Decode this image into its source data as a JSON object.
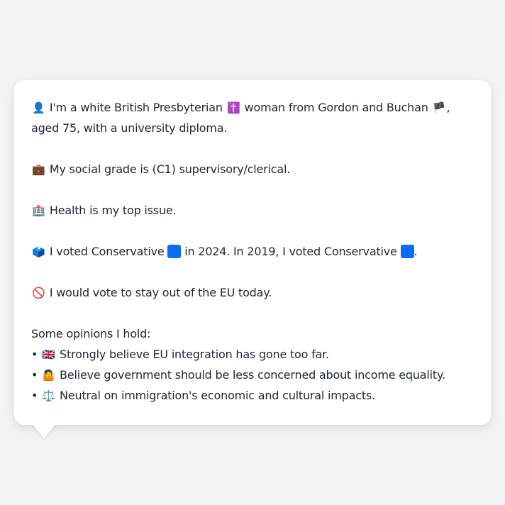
{
  "persona": {
    "identity": {
      "icon": "👤",
      "text_a": "I'm a white British Presbyterian",
      "religion_icon": "✝️",
      "text_b": "woman from Gordon and Buchan",
      "region_icon": "🏴",
      "text_c": ",",
      "line2": "aged 75, with a university diploma."
    },
    "grade": {
      "icon": "💼",
      "text": "My social grade is (C1) supervisory/clerical."
    },
    "issue": {
      "icon": "🏥",
      "text": "Health is my top issue."
    },
    "vote": {
      "icon": "🗳️",
      "text_a": "I voted Conservative",
      "text_b": "in 2024. In 2019, I voted Conservative",
      "text_c": ".",
      "party_color": "#0a6cf5"
    },
    "eu": {
      "icon": "🚫",
      "text": "I would vote to stay out of the EU today."
    },
    "opinions_heading": "Some opinions I hold:",
    "opinions": [
      {
        "bullet": "•",
        "icon": "🇬🇧",
        "text": "Strongly believe EU integration has gone too far."
      },
      {
        "bullet": "•",
        "icon": "🤷",
        "text": "Believe government should be less concerned about income equality."
      },
      {
        "bullet": "•",
        "icon": "⚖️",
        "text": "Neutral on immigration's economic and cultural impacts."
      }
    ]
  }
}
